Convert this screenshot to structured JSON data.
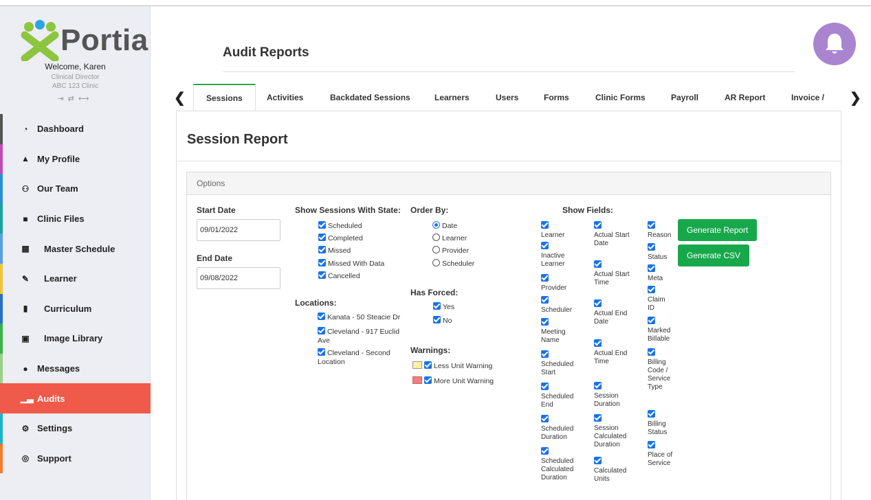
{
  "app": {
    "brand": "Portia",
    "brand_colors": {
      "green": "#8cc63f",
      "blue": "#2aa6df",
      "accent": "#f05a4a",
      "button": "#17a84b",
      "bell": "#a984cf"
    }
  },
  "user": {
    "welcome": "Welcome, Karen",
    "role": "Clinical Director",
    "clinic": "ABC 123 Clinic"
  },
  "sidebar": {
    "items": [
      {
        "label": "Dashboard",
        "icon": "dashboard-icon",
        "color": "#555"
      },
      {
        "label": "My Profile",
        "icon": "user-icon",
        "color": "#c34bb0"
      },
      {
        "label": "Our Team",
        "icon": "team-icon",
        "color": "#2a8fd6"
      },
      {
        "label": "Clinic Files",
        "icon": "file-icon",
        "color": "#1aa3a0"
      },
      {
        "label": "Master Schedule",
        "icon": "calendar-icon",
        "color": "#5aa0e6"
      },
      {
        "label": "Learner",
        "icon": "pencil-icon",
        "color": "#f0c43a"
      },
      {
        "label": "Curriculum",
        "icon": "book-icon",
        "color": "#2a6dc9"
      },
      {
        "label": "Image Library",
        "icon": "image-icon",
        "color": "#37b24d"
      },
      {
        "label": "Messages",
        "icon": "chat-icon",
        "color": "#9ad08a"
      },
      {
        "label": "Audits",
        "icon": "chart-icon",
        "color": "#f05a4a"
      },
      {
        "label": "Settings",
        "icon": "gear-icon",
        "color": "#1bb5c9"
      },
      {
        "label": "Support",
        "icon": "lifebuoy-icon",
        "color": "#f07d2a"
      }
    ]
  },
  "header": {
    "title": "Audit Reports"
  },
  "tabs": [
    "Sessions",
    "Activities",
    "Backdated Sessions",
    "Learners",
    "Users",
    "Forms",
    "Clinic Forms",
    "Payroll",
    "AR Report",
    "Invoice /"
  ],
  "report": {
    "title": "Session Report",
    "options_label": "Options",
    "start_date_label": "Start Date",
    "start_date": "09/01/2022",
    "end_date_label": "End Date",
    "end_date": "09/08/2022",
    "states_label": "Show Sessions With State:",
    "states": [
      "Scheduled",
      "Completed",
      "Missed",
      "Missed With Data",
      "Cancelled"
    ],
    "locations_label": "Locations:",
    "locations": [
      "Kanata - 50 Steacie Dr",
      "Cleveland - 917 Euclid Ave",
      "Cleveland - Second Location"
    ],
    "order_label": "Order By:",
    "order_options": [
      "Date",
      "Learner",
      "Provider",
      "Scheduler"
    ],
    "order_selected": "Date",
    "forced_label": "Has Forced:",
    "forced_options": [
      "Yes",
      "No"
    ],
    "warnings_label": "Warnings:",
    "warnings": [
      {
        "label": "Less Unit Warning",
        "color": "#fdf3a0"
      },
      {
        "label": "More Unit Warning",
        "color": "#f08080"
      }
    ],
    "fields_label": "Show Fields:",
    "fields_col1": [
      "Learner",
      "Inactive Learner",
      "Provider",
      "Scheduler",
      "Meeting Name",
      "Scheduled Start",
      "Scheduled End",
      "Scheduled Duration",
      "Scheduled Calculated Duration"
    ],
    "fields_col2": [
      "Actual Start Date",
      "Actual Start Time",
      "Actual End Date",
      "Actual End Time",
      "Session Duration",
      "Session Calculated Duration",
      "Calculated Units"
    ],
    "fields_col3": [
      "Reason",
      "Status",
      "Meta",
      "Claim ID",
      "Marked Billable",
      "Billing Code / Service Type",
      "Billing Status",
      "Place of Service"
    ],
    "generate_report": "Generate Report",
    "generate_csv": "Generate CSV"
  }
}
